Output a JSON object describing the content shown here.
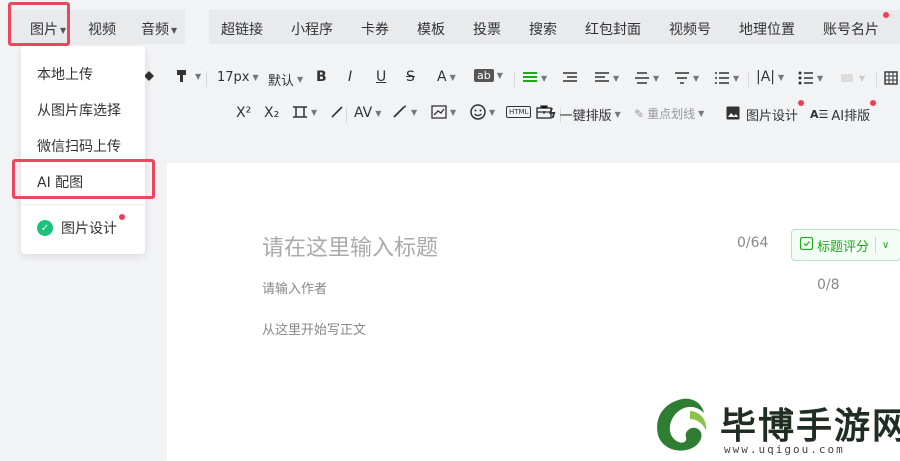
{
  "menu": {
    "left": [
      {
        "label": "图片",
        "caret": true
      },
      {
        "label": "视频",
        "caret": false
      },
      {
        "label": "音频",
        "caret": true
      }
    ],
    "right": [
      "超链接",
      "小程序",
      "卡券",
      "模板",
      "投票",
      "搜索",
      "红包封面",
      "视频号",
      "地理位置",
      "账号名片"
    ]
  },
  "toolbar": {
    "font_size": "17px",
    "font_family": "默认",
    "bold": "B",
    "italic": "I",
    "underline": "U",
    "strike": "S",
    "font_color": "A",
    "highlight": "ab",
    "superscript": "X²",
    "subscript": "X₂",
    "html_label": "HTML",
    "one_click_layout": "一键排版",
    "emphasis_line": "重点划线",
    "image_design": "图片设计",
    "ai_layout": "AI排版"
  },
  "dropdown": {
    "items": [
      "本地上传",
      "从图片库选择",
      "微信扫码上传",
      "AI 配图"
    ],
    "design": "图片设计"
  },
  "editor": {
    "title_placeholder": "请在这里输入标题",
    "title_count": "0/64",
    "score_label": "标题评分",
    "author_placeholder": "请输入作者",
    "author_count": "0/8",
    "body_placeholder": "从这里开始写正文"
  },
  "watermark": {
    "title": "毕博手游网",
    "url": "www.uqigou.com"
  },
  "colors": {
    "accent_green": "#1aad19",
    "highlight_red": "#e8495f",
    "badge_red": "#f33c52"
  }
}
